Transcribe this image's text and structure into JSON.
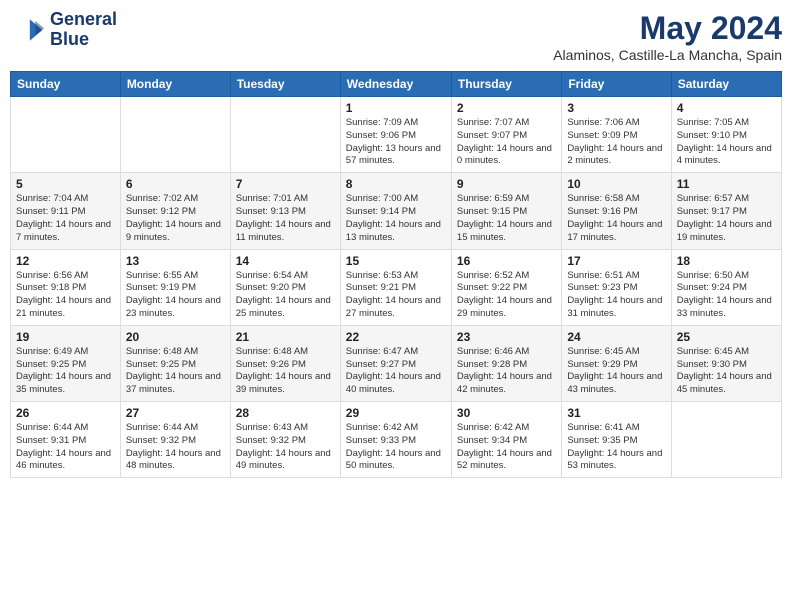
{
  "header": {
    "logo_line1": "General",
    "logo_line2": "Blue",
    "month": "May 2024",
    "location": "Alaminos, Castille-La Mancha, Spain"
  },
  "weekdays": [
    "Sunday",
    "Monday",
    "Tuesday",
    "Wednesday",
    "Thursday",
    "Friday",
    "Saturday"
  ],
  "weeks": [
    [
      {
        "day": "",
        "info": ""
      },
      {
        "day": "",
        "info": ""
      },
      {
        "day": "",
        "info": ""
      },
      {
        "day": "1",
        "info": "Sunrise: 7:09 AM\nSunset: 9:06 PM\nDaylight: 13 hours and 57 minutes."
      },
      {
        "day": "2",
        "info": "Sunrise: 7:07 AM\nSunset: 9:07 PM\nDaylight: 14 hours and 0 minutes."
      },
      {
        "day": "3",
        "info": "Sunrise: 7:06 AM\nSunset: 9:09 PM\nDaylight: 14 hours and 2 minutes."
      },
      {
        "day": "4",
        "info": "Sunrise: 7:05 AM\nSunset: 9:10 PM\nDaylight: 14 hours and 4 minutes."
      }
    ],
    [
      {
        "day": "5",
        "info": "Sunrise: 7:04 AM\nSunset: 9:11 PM\nDaylight: 14 hours and 7 minutes."
      },
      {
        "day": "6",
        "info": "Sunrise: 7:02 AM\nSunset: 9:12 PM\nDaylight: 14 hours and 9 minutes."
      },
      {
        "day": "7",
        "info": "Sunrise: 7:01 AM\nSunset: 9:13 PM\nDaylight: 14 hours and 11 minutes."
      },
      {
        "day": "8",
        "info": "Sunrise: 7:00 AM\nSunset: 9:14 PM\nDaylight: 14 hours and 13 minutes."
      },
      {
        "day": "9",
        "info": "Sunrise: 6:59 AM\nSunset: 9:15 PM\nDaylight: 14 hours and 15 minutes."
      },
      {
        "day": "10",
        "info": "Sunrise: 6:58 AM\nSunset: 9:16 PM\nDaylight: 14 hours and 17 minutes."
      },
      {
        "day": "11",
        "info": "Sunrise: 6:57 AM\nSunset: 9:17 PM\nDaylight: 14 hours and 19 minutes."
      }
    ],
    [
      {
        "day": "12",
        "info": "Sunrise: 6:56 AM\nSunset: 9:18 PM\nDaylight: 14 hours and 21 minutes."
      },
      {
        "day": "13",
        "info": "Sunrise: 6:55 AM\nSunset: 9:19 PM\nDaylight: 14 hours and 23 minutes."
      },
      {
        "day": "14",
        "info": "Sunrise: 6:54 AM\nSunset: 9:20 PM\nDaylight: 14 hours and 25 minutes."
      },
      {
        "day": "15",
        "info": "Sunrise: 6:53 AM\nSunset: 9:21 PM\nDaylight: 14 hours and 27 minutes."
      },
      {
        "day": "16",
        "info": "Sunrise: 6:52 AM\nSunset: 9:22 PM\nDaylight: 14 hours and 29 minutes."
      },
      {
        "day": "17",
        "info": "Sunrise: 6:51 AM\nSunset: 9:23 PM\nDaylight: 14 hours and 31 minutes."
      },
      {
        "day": "18",
        "info": "Sunrise: 6:50 AM\nSunset: 9:24 PM\nDaylight: 14 hours and 33 minutes."
      }
    ],
    [
      {
        "day": "19",
        "info": "Sunrise: 6:49 AM\nSunset: 9:25 PM\nDaylight: 14 hours and 35 minutes."
      },
      {
        "day": "20",
        "info": "Sunrise: 6:48 AM\nSunset: 9:25 PM\nDaylight: 14 hours and 37 minutes."
      },
      {
        "day": "21",
        "info": "Sunrise: 6:48 AM\nSunset: 9:26 PM\nDaylight: 14 hours and 39 minutes."
      },
      {
        "day": "22",
        "info": "Sunrise: 6:47 AM\nSunset: 9:27 PM\nDaylight: 14 hours and 40 minutes."
      },
      {
        "day": "23",
        "info": "Sunrise: 6:46 AM\nSunset: 9:28 PM\nDaylight: 14 hours and 42 minutes."
      },
      {
        "day": "24",
        "info": "Sunrise: 6:45 AM\nSunset: 9:29 PM\nDaylight: 14 hours and 43 minutes."
      },
      {
        "day": "25",
        "info": "Sunrise: 6:45 AM\nSunset: 9:30 PM\nDaylight: 14 hours and 45 minutes."
      }
    ],
    [
      {
        "day": "26",
        "info": "Sunrise: 6:44 AM\nSunset: 9:31 PM\nDaylight: 14 hours and 46 minutes."
      },
      {
        "day": "27",
        "info": "Sunrise: 6:44 AM\nSunset: 9:32 PM\nDaylight: 14 hours and 48 minutes."
      },
      {
        "day": "28",
        "info": "Sunrise: 6:43 AM\nSunset: 9:32 PM\nDaylight: 14 hours and 49 minutes."
      },
      {
        "day": "29",
        "info": "Sunrise: 6:42 AM\nSunset: 9:33 PM\nDaylight: 14 hours and 50 minutes."
      },
      {
        "day": "30",
        "info": "Sunrise: 6:42 AM\nSunset: 9:34 PM\nDaylight: 14 hours and 52 minutes."
      },
      {
        "day": "31",
        "info": "Sunrise: 6:41 AM\nSunset: 9:35 PM\nDaylight: 14 hours and 53 minutes."
      },
      {
        "day": "",
        "info": ""
      }
    ]
  ]
}
